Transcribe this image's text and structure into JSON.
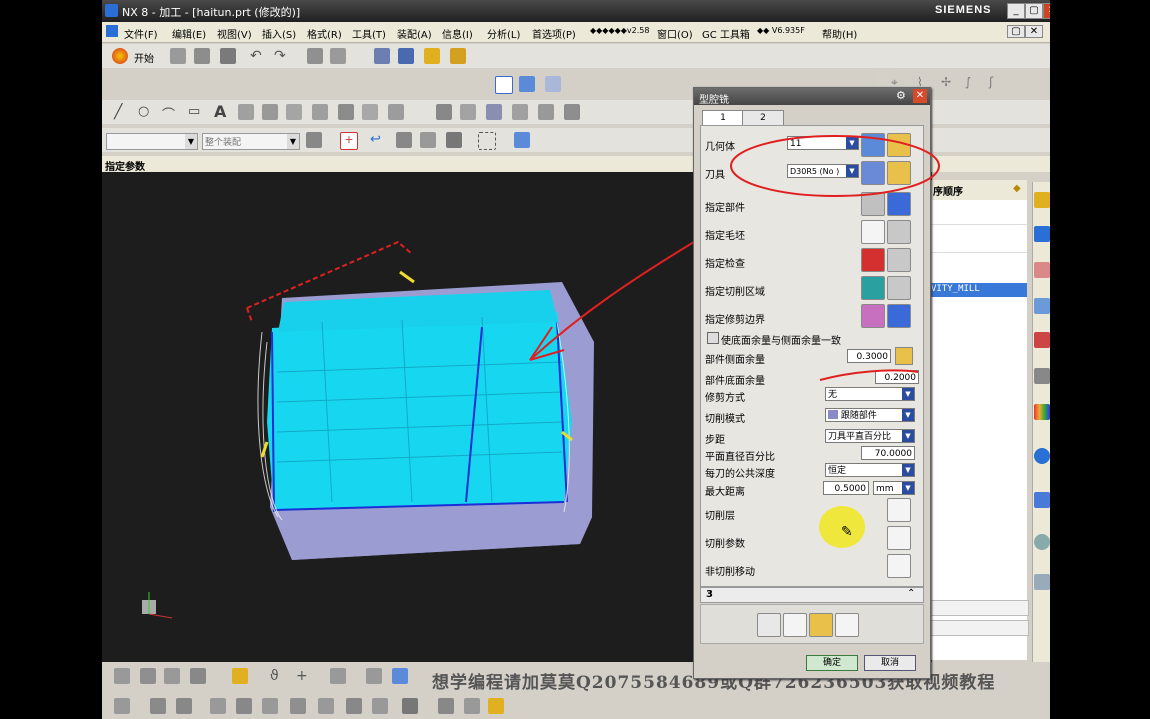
{
  "window": {
    "title": "NX 8 - 加工 - [haitun.prt (修改的)]",
    "brand": "SIEMENS"
  },
  "menu": [
    "文件(F)",
    "编辑(E)",
    "视图(V)",
    "插入(S)",
    "格式(R)",
    "工具(T)",
    "装配(A)",
    "信息(I)",
    "分析(L)",
    "首选项(P)",
    "◆◆◆◆◆◆v2.58",
    "窗口(O)",
    "GC 工具箱",
    "◆◆ V6.935F",
    "帮助(H)"
  ],
  "toolbar": {
    "start_label": "开始",
    "filter_placeholder": "整个装配"
  },
  "label_bar": "指定参数",
  "nav_panel": {
    "header": "序顺序",
    "selected_row": "VITY_MILL"
  },
  "dialog": {
    "title": "型腔铣",
    "tabs": [
      "1",
      "2"
    ],
    "geometry_label": "几何体",
    "geometry_value": "11",
    "tool_label": "刀具",
    "tool_value": "D30R5 (No )",
    "specify_part": "指定部件",
    "specify_blank": "指定毛坯",
    "specify_check": "指定检查",
    "specify_cut_area": "指定切削区域",
    "specify_trim": "指定修剪边界",
    "checkbox_label": "使底面余量与侧面余量一致",
    "part_side_stock_label": "部件侧面余量",
    "part_side_stock_value": "0.3000",
    "part_floor_stock_label": "部件底面余量",
    "part_floor_stock_value": "0.2000",
    "trim_method_label": "修剪方式",
    "trim_method_value": "无",
    "cut_pattern_label": "切削模式",
    "cut_pattern_value": "跟随部件",
    "stepover_label": "步距",
    "stepover_value": "刀具平直百分比",
    "flat_diameter_label": "平面直径百分比",
    "flat_diameter_value": "70.0000",
    "common_depth_label": "每刀的公共深度",
    "common_depth_value": "恒定",
    "max_distance_label": "最大距离",
    "max_distance_value": "0.5000",
    "max_distance_unit": "mm",
    "cut_levels": "切削层",
    "cut_params": "切削参数",
    "non_cut_moves": "非切削移动",
    "section_number": "3",
    "ok": "确定",
    "cancel": "取消"
  },
  "watermark": "想学编程请加莫莫Q2075584689或Q群726236503获取视频教程"
}
